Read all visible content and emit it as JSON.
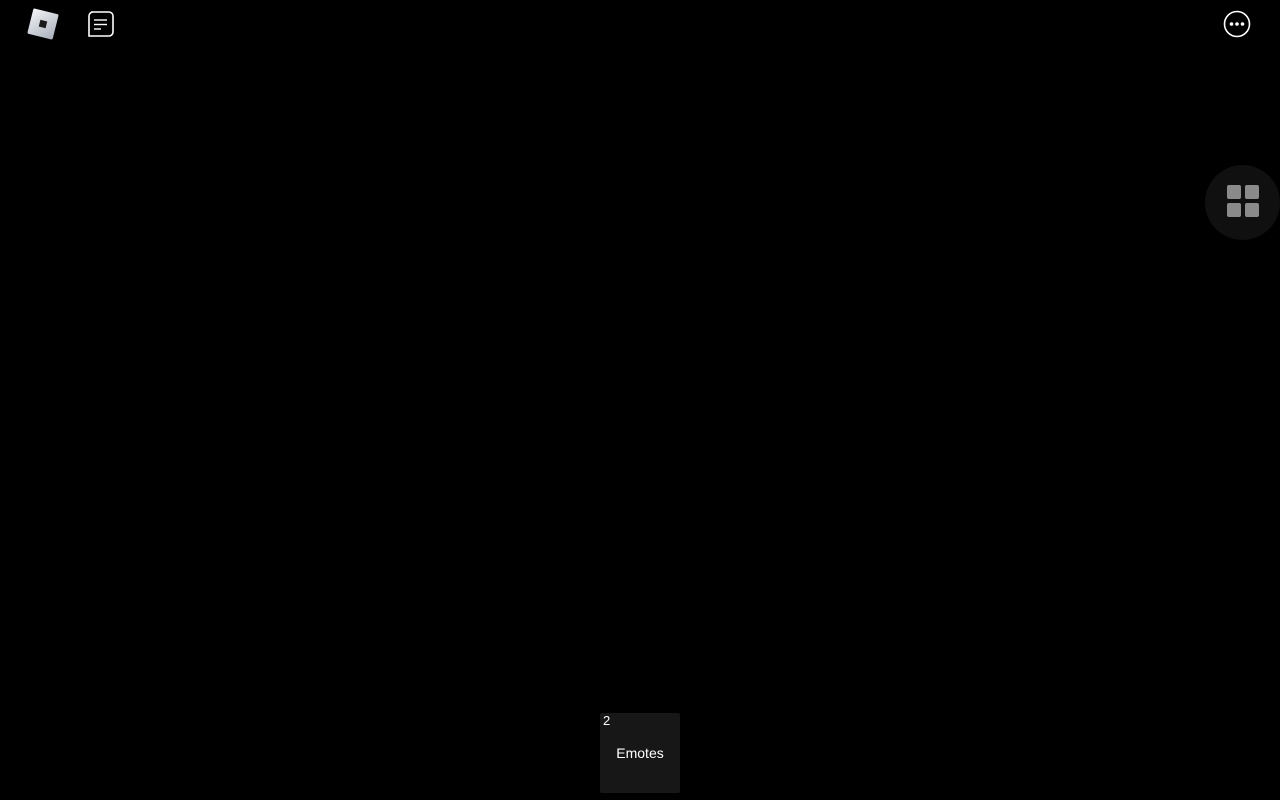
{
  "topbar": {
    "roblox_menu_icon": "roblox-logo-icon",
    "chat_icon": "chat-icon",
    "more_icon": "more-options-icon"
  },
  "side_menu": {
    "toggle_icon": "grid-icon"
  },
  "hotbar": {
    "slots": [
      {
        "number": "2",
        "label": "Emotes"
      }
    ]
  },
  "colors": {
    "background": "#000000",
    "slot_bg": "#171717",
    "toggle_bg": "#101010",
    "icon": "#ffffff",
    "grid_icon": "#8a8a8a"
  }
}
